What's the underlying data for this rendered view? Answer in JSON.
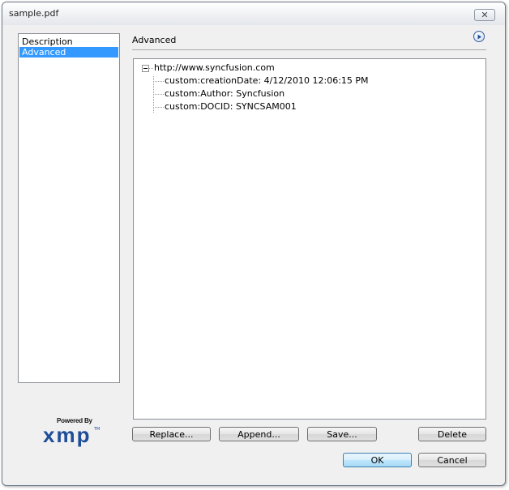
{
  "window": {
    "title": "sample.pdf",
    "close_glyph": "✕"
  },
  "sidebar": {
    "items": [
      {
        "label": "Description",
        "selected": false
      },
      {
        "label": "Advanced",
        "selected": true
      }
    ]
  },
  "panel": {
    "title": "Advanced",
    "menu_icon": "arrow-right-circle-icon"
  },
  "tree": {
    "root": "http://www.syncfusion.com",
    "expander_icon": "collapse-minus-icon",
    "children": [
      "custom:creationDate: 4/12/2010 12:06:15 PM",
      "custom:Author: Syncfusion",
      "custom:DOCID: SYNCSAM001"
    ]
  },
  "buttons": {
    "replace": "Replace...",
    "append": "Append...",
    "save": "Save...",
    "delete": "Delete",
    "ok": "OK",
    "cancel": "Cancel"
  },
  "logo": {
    "powered_by": "Powered By",
    "mark": "xmp",
    "tm": "TM"
  },
  "colors": {
    "selection": "#3399ff",
    "logo_blue": "#1f4e98"
  }
}
